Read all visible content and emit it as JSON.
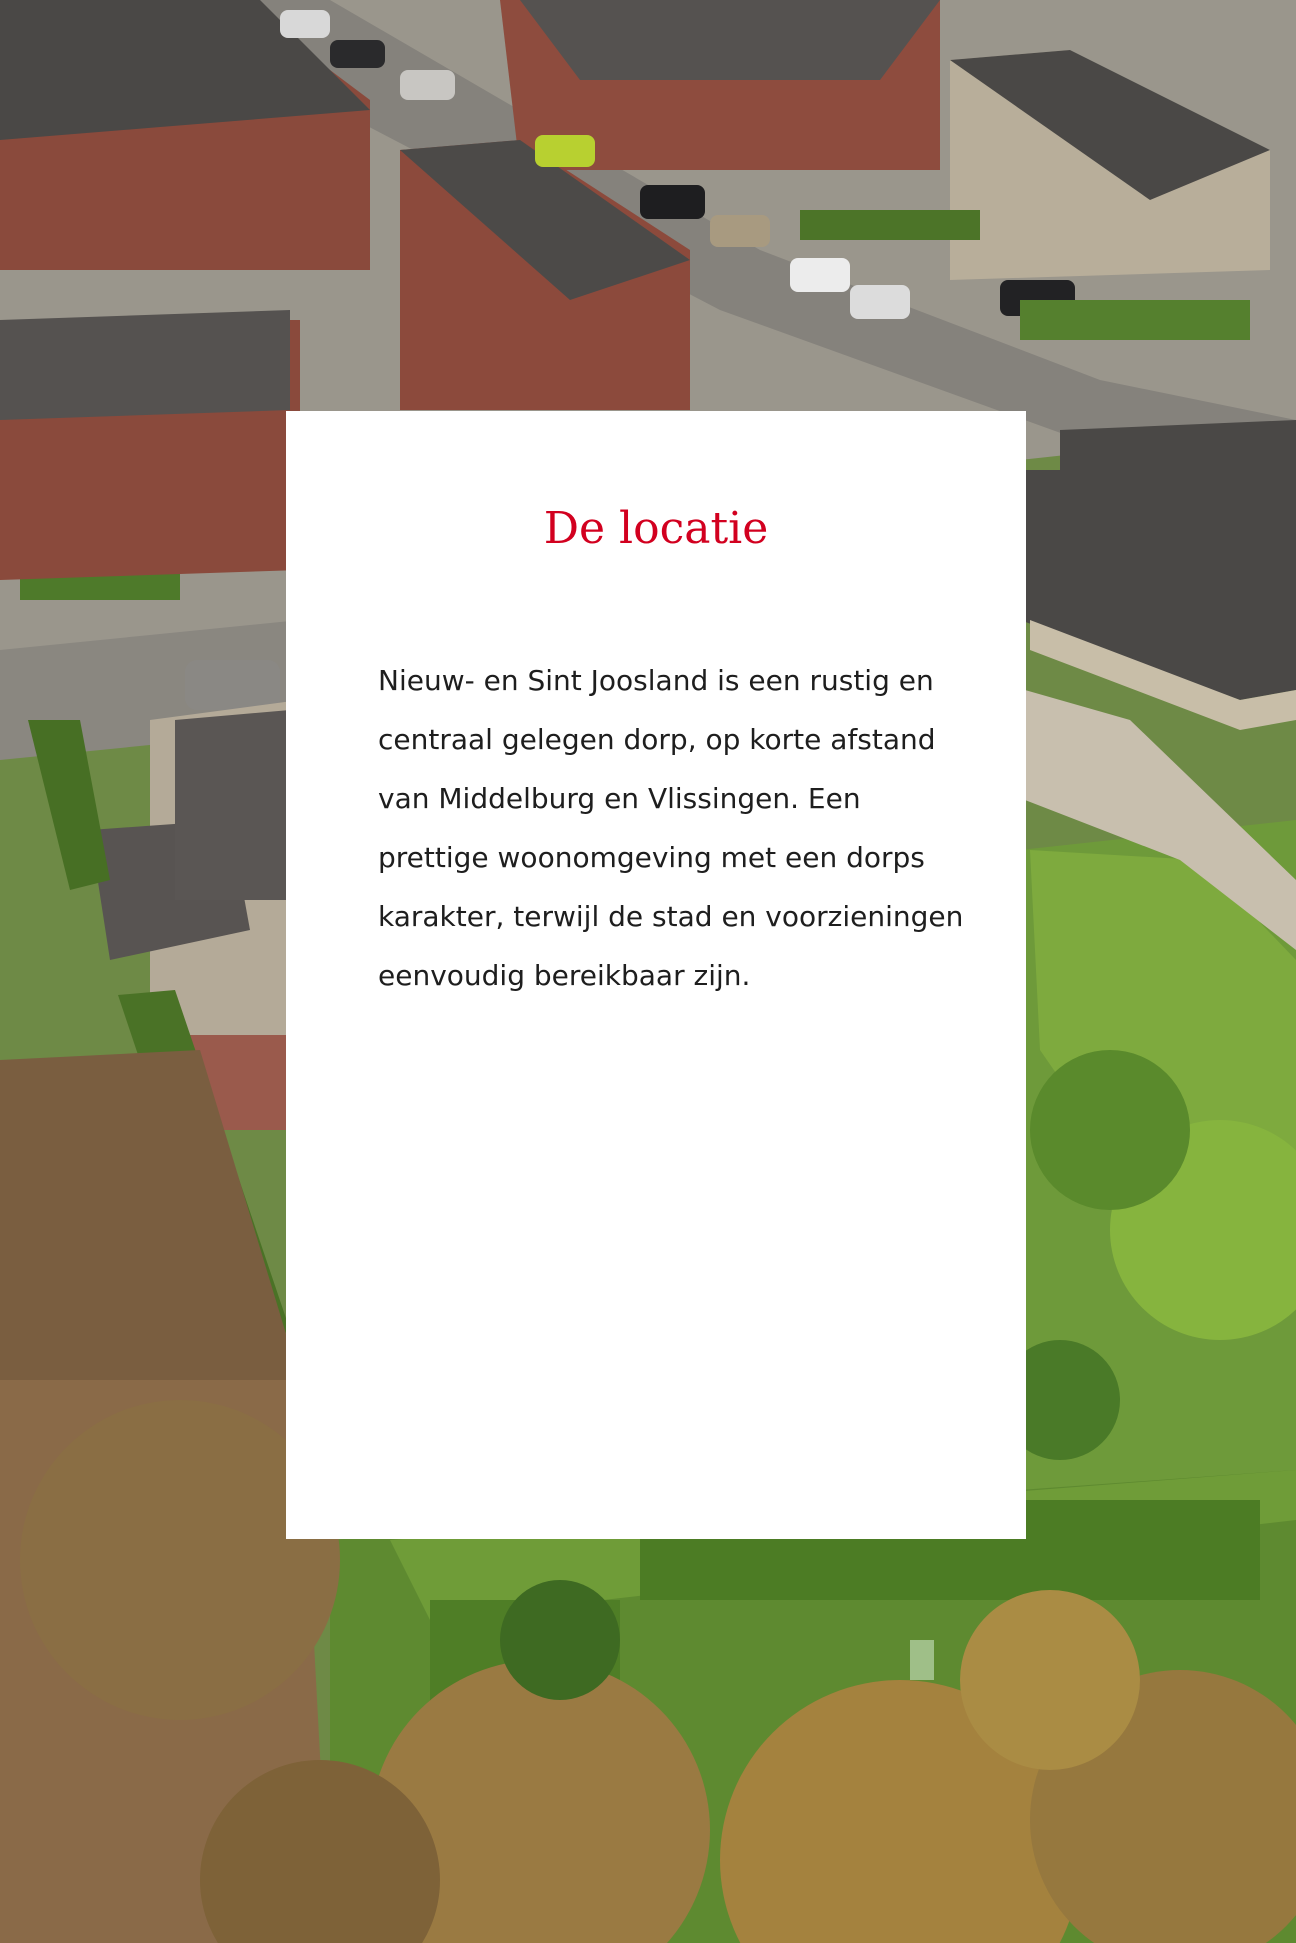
{
  "background": {
    "icon": "aerial-village-photo",
    "colors": {
      "road": "#8c8a86",
      "roof": "#4a4846",
      "brick": "#8a4a3c",
      "lawn": "#6f9a3c",
      "hedge": "#4f7a2a",
      "soil": "#7a5e40",
      "tree_autumn": "#a07a40"
    }
  },
  "card": {
    "title": "De locatie",
    "body": "Nieuw- en Sint Joosland is een rustig en centraal gelegen dorp, op korte afstand van Middelburg en Vlissingen. Een prettige woonomgeving met een dorps karakter, terwijl de stad en voorzieningen eenvoudig bereikbaar zijn.",
    "title_color": "#d2001f",
    "background_color": "#ffffff"
  }
}
